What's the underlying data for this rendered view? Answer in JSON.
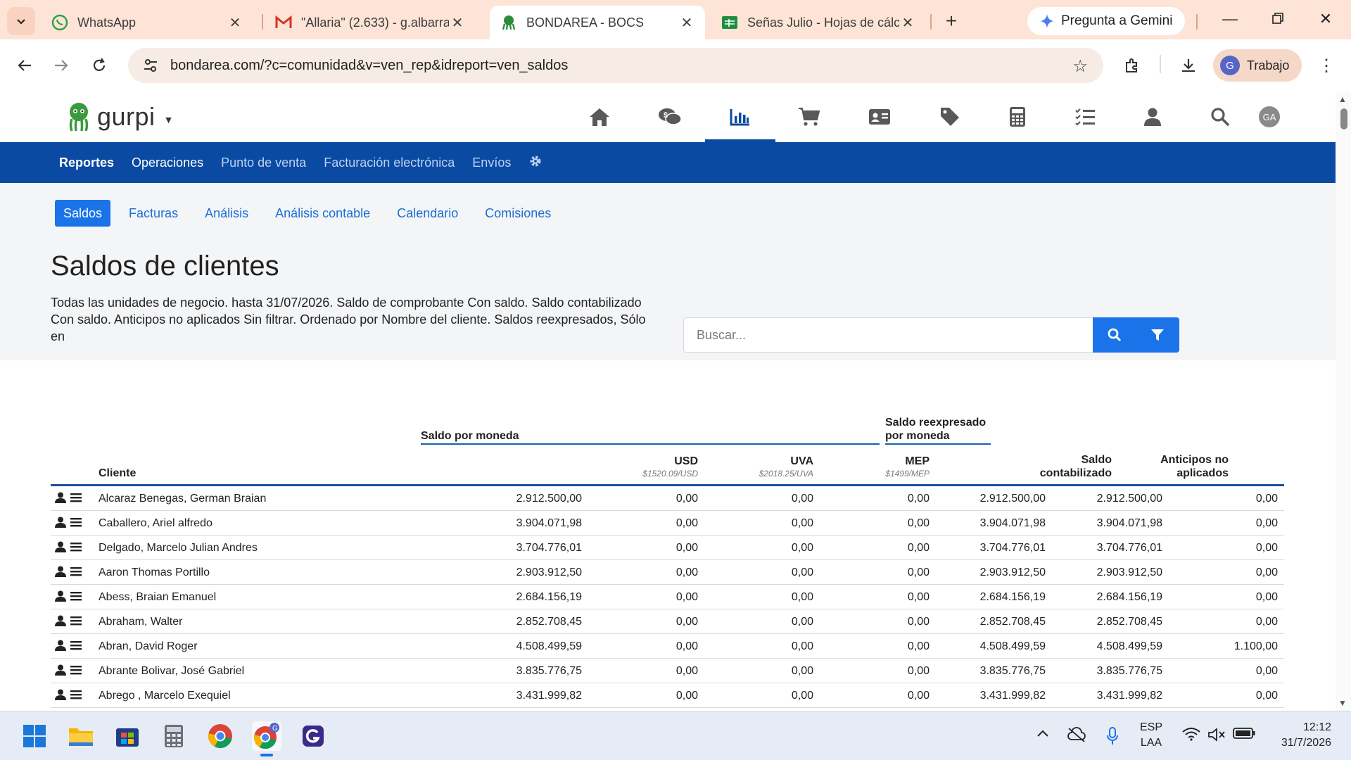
{
  "browser": {
    "tabs": [
      {
        "title": "WhatsApp",
        "active": false
      },
      {
        "title": "\"Allaria\" (2.633) - g.albarra",
        "active": false
      },
      {
        "title": "BONDAREA - BOCS",
        "active": true
      },
      {
        "title": "Señas Julio - Hojas de cálc",
        "active": false
      }
    ],
    "gemini_label": "Pregunta a Gemini",
    "url": "bondarea.com/?c=comunidad&v=ven_rep&idreport=ven_saldos",
    "profile_label": "Trabajo",
    "profile_initial": "G"
  },
  "app": {
    "brand": "gurpi",
    "user_initials": "GA",
    "top_icons": [
      "home-icon",
      "money-chat-icon",
      "chart-icon",
      "cart-icon",
      "id-card-icon",
      "tag-icon",
      "calculator-icon",
      "checklist-icon",
      "user-icon",
      "search-icon"
    ],
    "nav": [
      "Reportes",
      "Operaciones",
      "Punto de venta",
      "Facturación electrónica",
      "Envíos"
    ],
    "subtabs": [
      "Saldos",
      "Facturas",
      "Análisis",
      "Análisis contable",
      "Calendario",
      "Comisiones"
    ],
    "title": "Saldos de clientes",
    "description": "Todas las unidades de negocio. hasta 31/07/2026. Saldo de comprobante Con saldo. Saldo contabilizado Con saldo. Anticipos no aplicados Sin filtrar. Ordenado por Nombre del cliente. Saldos reexpresados, Sólo en",
    "search_placeholder": "Buscar..."
  },
  "table": {
    "group_currency": "Saldo por moneda",
    "group_restated_1": "Saldo reexpresado",
    "group_restated_2": "por moneda",
    "col_client": "Cliente",
    "col_usd": "USD",
    "rate_usd": "$1520.09/USD",
    "col_uva": "UVA",
    "rate_uva": "$2018.25/UVA",
    "col_mep": "MEP",
    "rate_mep": "$1499/MEP",
    "col_booked_1": "Saldo",
    "col_booked_2": "contabilizado",
    "col_adv_1": "Anticipos no",
    "col_adv_2": "aplicados",
    "rows": [
      {
        "client": "Alcaraz Benegas, German Braian",
        "ars": "2.912.500,00",
        "usd": "0,00",
        "uva": "0,00",
        "mep": "0,00",
        "restated": "2.912.500,00",
        "booked": "2.912.500,00",
        "advances": "0,00"
      },
      {
        "client": "Caballero, Ariel alfredo",
        "ars": "3.904.071,98",
        "usd": "0,00",
        "uva": "0,00",
        "mep": "0,00",
        "restated": "3.904.071,98",
        "booked": "3.904.071,98",
        "advances": "0,00"
      },
      {
        "client": "Delgado, Marcelo Julian Andres",
        "ars": "3.704.776,01",
        "usd": "0,00",
        "uva": "0,00",
        "mep": "0,00",
        "restated": "3.704.776,01",
        "booked": "3.704.776,01",
        "advances": "0,00"
      },
      {
        "client": "Aaron Thomas Portillo",
        "ars": "2.903.912,50",
        "usd": "0,00",
        "uva": "0,00",
        "mep": "0,00",
        "restated": "2.903.912,50",
        "booked": "2.903.912,50",
        "advances": "0,00"
      },
      {
        "client": "Abess, Braian Emanuel",
        "ars": "2.684.156,19",
        "usd": "0,00",
        "uva": "0,00",
        "mep": "0,00",
        "restated": "2.684.156,19",
        "booked": "2.684.156,19",
        "advances": "0,00"
      },
      {
        "client": "Abraham, Walter",
        "ars": "2.852.708,45",
        "usd": "0,00",
        "uva": "0,00",
        "mep": "0,00",
        "restated": "2.852.708,45",
        "booked": "2.852.708,45",
        "advances": "0,00"
      },
      {
        "client": "Abran, David Roger",
        "ars": "4.508.499,59",
        "usd": "0,00",
        "uva": "0,00",
        "mep": "0,00",
        "restated": "4.508.499,59",
        "booked": "4.508.499,59",
        "advances": "1.100,00"
      },
      {
        "client": "Abrante Bolivar, José Gabriel",
        "ars": "3.835.776,75",
        "usd": "0,00",
        "uva": "0,00",
        "mep": "0,00",
        "restated": "3.835.776,75",
        "booked": "3.835.776,75",
        "advances": "0,00"
      },
      {
        "client": "Abrego , Marcelo Exequiel",
        "ars": "3.431.999,82",
        "usd": "0,00",
        "uva": "0,00",
        "mep": "0,00",
        "restated": "3.431.999,82",
        "booked": "3.431.999,82",
        "advances": "0,00"
      }
    ]
  },
  "taskbar": {
    "lang_1": "ESP",
    "lang_2": "LAA",
    "time": "12:12",
    "date": "31/7/2026"
  },
  "colors": {
    "brand_blue": "#0b4aa2",
    "accent_blue": "#1a73e8",
    "tabstrip": "#fde4d6"
  }
}
